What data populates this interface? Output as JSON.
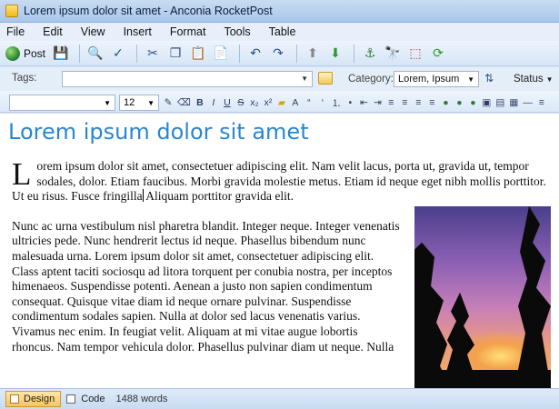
{
  "window": {
    "title": "Lorem ipsum dolor sit amet - Anconia RocketPost"
  },
  "menu": [
    "File",
    "Edit",
    "View",
    "Insert",
    "Format",
    "Tools",
    "Table"
  ],
  "toolbar": {
    "post_label": "Post",
    "icons": [
      "save-icon",
      "preview-icon",
      "spellcheck-icon",
      "cut-icon",
      "copy-icon",
      "paste-icon",
      "paste-special-icon",
      "undo-icon",
      "redo-icon",
      "back-icon",
      "forward-icon",
      "link-icon",
      "find-icon",
      "select-icon",
      "refresh-icon"
    ]
  },
  "meta": {
    "tags_label": "Tags:",
    "tags_value": "",
    "category_label": "Category:",
    "category_value": "Lorem, Ipsum",
    "status_label": "Status"
  },
  "format": {
    "style_value": "",
    "size_value": "12",
    "buttons": [
      "B",
      "I",
      "U",
      "S",
      "x₂",
      "x²",
      "A",
      "“",
      "‘",
      "≡",
      "≡",
      "≡",
      "≡",
      "≡",
      "≡"
    ]
  },
  "document": {
    "title": "Lorem ipsum dolor sit amet",
    "drop_cap": "L",
    "para1_a": "orem ipsum dolor sit amet, consectetuer adipiscing elit. Nam velit lacus, porta ut, gravida ut, tempor sodales, dolor. Etiam faucibus. Morbi gravida molestie metus. Etiam id neque eget nibh mollis porttitor. Ut eu risus. Fusce fringilla",
    "para1_b": " Aliquam porttitor gravida elit.",
    "para2": "Nunc ac urna vestibulum nisl pharetra blandit. Integer neque. Integer venenatis ultricies pede. Nunc hendrerit lectus id neque. Phasellus bibendum nunc malesuada urna. Lorem ipsum dolor sit amet, consectetuer adipiscing elit. Class aptent taciti sociosqu ad litora torquent per conubia nostra, per inceptos himenaeos. Suspendisse potenti. Aenean a justo non sapien condimentum consequat. Quisque vitae diam id neque ornare pulvinar. Suspendisse condimentum sodales sapien. Nulla at dolor sed lacus venenatis varius. Vivamus nec enim. In feugiat velit. Aliquam at mi vitae augue lobortis rhoncus. Nam tempor vehicula dolor. Phasellus pulvinar diam ut neque. Nulla"
  },
  "statusbar": {
    "design_tab": "Design",
    "code_tab": "Code",
    "word_count": "1488 words"
  }
}
